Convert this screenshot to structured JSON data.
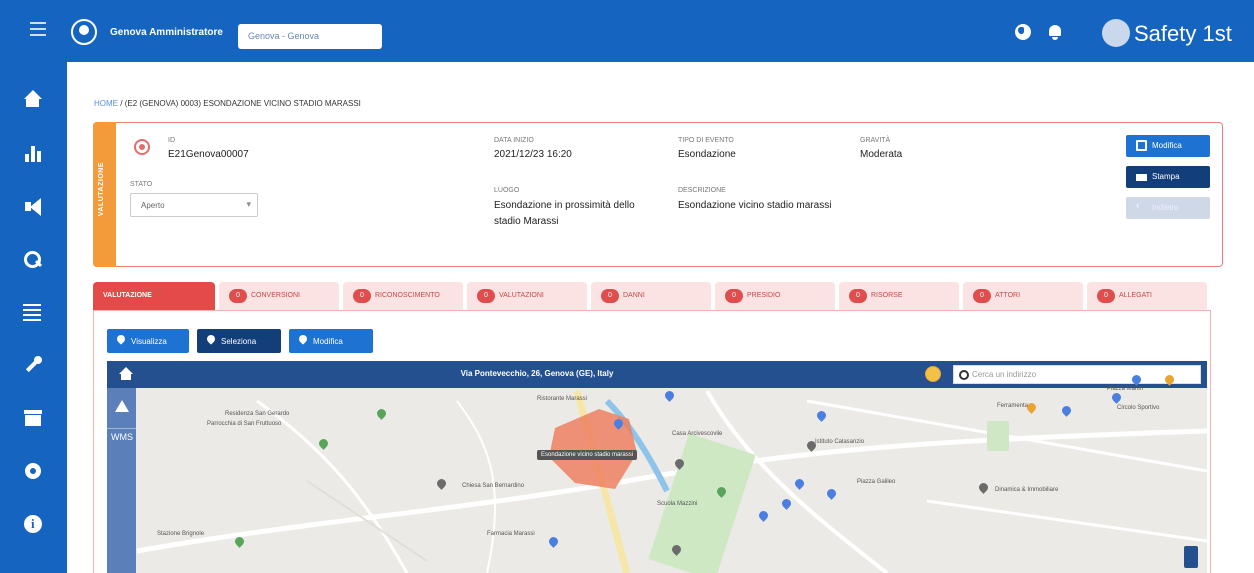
{
  "topbar": {
    "user_name": "Genova Amministratore",
    "selector_value": "Genova - Genova",
    "brand": "Safety 1st"
  },
  "sidebar": {
    "items": [
      "home-icon",
      "organization-icon",
      "megaphone-icon",
      "search-icon",
      "list-icon",
      "wrench-icon",
      "archive-icon",
      "gear-icon",
      "info-icon"
    ]
  },
  "breadcrumb": {
    "home": "HOME",
    "sep": "/",
    "current": "(E2 (GENOVA) 0003) ESONDAZIONE VICINO STADIO MARASSI"
  },
  "card": {
    "tag": "VALUTAZIONE",
    "id_label": "ID",
    "id_value": "E21Genova00007",
    "stato_label": "STATO",
    "stato_value": "Aperto",
    "data_label": "DATA INIZIO",
    "data_value": "2021/12/23 16:20",
    "tipo_label": "TIPO DI EVENTO",
    "tipo_value": "Esondazione",
    "gravita_label": "GRAVITÀ",
    "gravita_value": "Moderata",
    "luogo_label": "LUOGO",
    "luogo_value_1": "Esondazione in prossimità dello",
    "luogo_value_2": "stadio Marassi",
    "desc_label": "DESCRIZIONE",
    "desc_value": "Esondazione vicino stadio marassi"
  },
  "actions": {
    "modifica": "Modifica",
    "stampa": "Stampa",
    "indietro": "Indietro"
  },
  "tabs": [
    {
      "label": "VALUTAZIONE",
      "count": ""
    },
    {
      "label": "CONVERSIONI",
      "count": "0"
    },
    {
      "label": "RICONOSCIMENTO",
      "count": "0"
    },
    {
      "label": "VALUTAZIONI",
      "count": "0"
    },
    {
      "label": "DANNI",
      "count": "0"
    },
    {
      "label": "PRESIDIO",
      "count": "0"
    },
    {
      "label": "RISORSE",
      "count": "0"
    },
    {
      "label": "ATTORI",
      "count": "0"
    },
    {
      "label": "ALLEGATI",
      "count": "0"
    }
  ],
  "map_buttons": {
    "visualizza": "Visualizza",
    "seleziona": "Seleziona",
    "modifica": "Modifica"
  },
  "map": {
    "title": "Via Pontevecchio, 26, Genova (GE), Italy",
    "search_placeholder": "Cerca un indirizzo",
    "wms": "WMS",
    "area_label": "Esondazione vicino stadio marassi",
    "places": [
      "Residenza San Gerardo",
      "Parrocchia di San Fruttuoso",
      "Chiesa San Bernardino",
      "Ristorante Marassi",
      "Casa Arcivescovile",
      "Scuola Mazzini",
      "Istituto Calasanzio",
      "Piazza Galileo",
      "Ferramenta",
      "Dinamica & Immobiliare",
      "Farmacia Marassi",
      "Stazione Brignole",
      "Piazza Manin",
      "Circolo Sportivo"
    ]
  }
}
